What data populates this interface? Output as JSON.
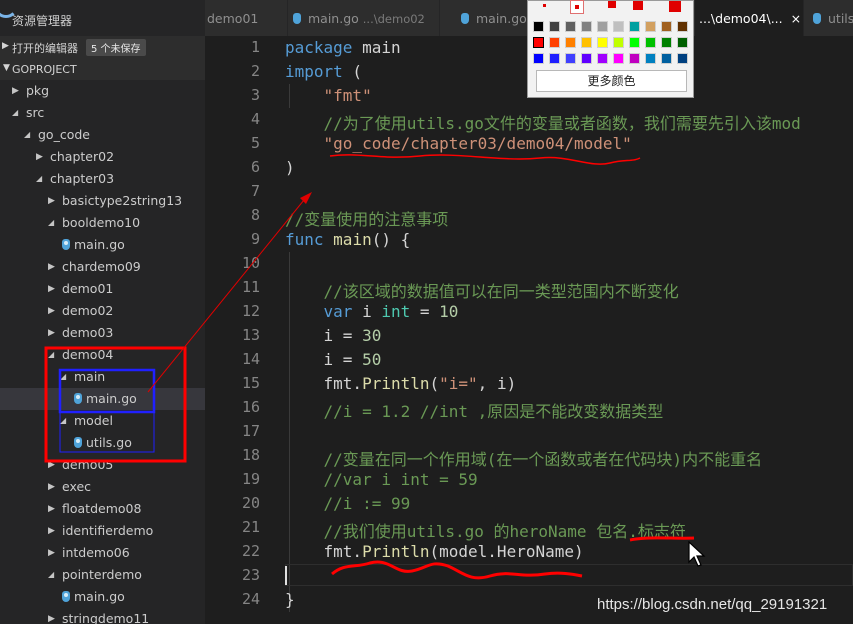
{
  "sidebar": {
    "title": "资源管理器",
    "open_editors": "打开的编辑器",
    "unsaved_badge": "5 个未保存",
    "project": "GOPROJECT",
    "tree": [
      {
        "label": "pkg",
        "depth": 0,
        "kind": "folder",
        "open": false
      },
      {
        "label": "src",
        "depth": 0,
        "kind": "folder",
        "open": true
      },
      {
        "label": "go_code",
        "depth": 1,
        "kind": "folder",
        "open": true
      },
      {
        "label": "chapter02",
        "depth": 2,
        "kind": "folder",
        "open": false
      },
      {
        "label": "chapter03",
        "depth": 2,
        "kind": "folder",
        "open": true
      },
      {
        "label": "basictype2string13",
        "depth": 3,
        "kind": "folder",
        "open": false
      },
      {
        "label": "booldemo10",
        "depth": 3,
        "kind": "folder",
        "open": true
      },
      {
        "label": "main.go",
        "depth": 4,
        "kind": "file"
      },
      {
        "label": "chardemo09",
        "depth": 3,
        "kind": "folder",
        "open": false
      },
      {
        "label": "demo01",
        "depth": 3,
        "kind": "folder",
        "open": false
      },
      {
        "label": "demo02",
        "depth": 3,
        "kind": "folder",
        "open": false
      },
      {
        "label": "demo03",
        "depth": 3,
        "kind": "folder",
        "open": false
      },
      {
        "label": "demo04",
        "depth": 3,
        "kind": "folder",
        "open": true
      },
      {
        "label": "main",
        "depth": 4,
        "kind": "folder",
        "open": true
      },
      {
        "label": "main.go",
        "depth": 5,
        "kind": "file",
        "selected": true
      },
      {
        "label": "model",
        "depth": 4,
        "kind": "folder",
        "open": true
      },
      {
        "label": "utils.go",
        "depth": 5,
        "kind": "file"
      },
      {
        "label": "demo05",
        "depth": 3,
        "kind": "folder",
        "open": false
      },
      {
        "label": "exec",
        "depth": 3,
        "kind": "folder",
        "open": false
      },
      {
        "label": "floatdemo08",
        "depth": 3,
        "kind": "folder",
        "open": false
      },
      {
        "label": "identifierdemo",
        "depth": 3,
        "kind": "folder",
        "open": false
      },
      {
        "label": "intdemo06",
        "depth": 3,
        "kind": "folder",
        "open": false
      },
      {
        "label": "pointerdemo",
        "depth": 3,
        "kind": "folder",
        "open": true
      },
      {
        "label": "main.go",
        "depth": 4,
        "kind": "file"
      },
      {
        "label": "stringdemo11",
        "depth": 3,
        "kind": "folder",
        "open": false
      }
    ]
  },
  "tabs": [
    {
      "name": "demo01",
      "path": "",
      "active": false
    },
    {
      "name": "main.go",
      "path": "...\\demo02",
      "active": false
    },
    {
      "name": "main.go",
      "path": "",
      "active": false
    },
    {
      "name": "...\\demo04\\...",
      "path": "",
      "active": true,
      "close": "×"
    },
    {
      "name": "utils",
      "path": "",
      "active": false
    }
  ],
  "color_picker": {
    "more_colors": "更多颜色",
    "colors": [
      "#000000",
      "#404040",
      "#606060",
      "#808080",
      "#a0a0a0",
      "#c0c0c0",
      "#00a0a0",
      "#d2a060",
      "#a06020",
      "#603000",
      "#ff0000",
      "#ff4000",
      "#ff8000",
      "#ffc000",
      "#ffff00",
      "#c0ff00",
      "#00ff00",
      "#00c000",
      "#008000",
      "#006000",
      "#0000ff",
      "#2020ff",
      "#4040ff",
      "#6000ff",
      "#a000ff",
      "#ff00ff",
      "#c000c0",
      "#0080c0",
      "#0060a0",
      "#004080"
    ]
  },
  "code_lines": [
    {
      "n": "1",
      "segs": [
        [
          "kw",
          "package"
        ],
        [
          "wh",
          " main"
        ]
      ]
    },
    {
      "n": "2",
      "segs": [
        [
          "kw",
          "import"
        ],
        [
          "wh",
          " ("
        ]
      ]
    },
    {
      "n": "3",
      "segs": [
        [
          "wh",
          "    "
        ],
        [
          "str",
          "\"fmt\""
        ]
      ]
    },
    {
      "n": "4",
      "segs": [
        [
          "wh",
          "    "
        ],
        [
          "cm",
          "//为了使用utils.go文件的变量或者函数，我们需要先引入该mod"
        ]
      ]
    },
    {
      "n": "5",
      "segs": [
        [
          "wh",
          "    "
        ],
        [
          "str",
          "\"go_code/chapter03/demo04/model\""
        ]
      ]
    },
    {
      "n": "6",
      "segs": [
        [
          "wh",
          ")"
        ]
      ]
    },
    {
      "n": "7",
      "segs": []
    },
    {
      "n": "8",
      "segs": [
        [
          "cm",
          "//变量使用的注意事项"
        ]
      ]
    },
    {
      "n": "9",
      "segs": [
        [
          "kw",
          "func"
        ],
        [
          "wh",
          " "
        ],
        [
          "fn",
          "main"
        ],
        [
          "wh",
          "() {"
        ]
      ]
    },
    {
      "n": "10",
      "segs": []
    },
    {
      "n": "11",
      "segs": [
        [
          "wh",
          "    "
        ],
        [
          "cm",
          "//该区域的数据值可以在同一类型范围内不断变化"
        ]
      ]
    },
    {
      "n": "12",
      "segs": [
        [
          "wh",
          "    "
        ],
        [
          "kw",
          "var"
        ],
        [
          "wh",
          " i "
        ],
        [
          "ty",
          "int"
        ],
        [
          "wh",
          " = "
        ],
        [
          "nu",
          "10"
        ]
      ]
    },
    {
      "n": "13",
      "segs": [
        [
          "wh",
          "    i = "
        ],
        [
          "nu",
          "30"
        ]
      ]
    },
    {
      "n": "14",
      "segs": [
        [
          "wh",
          "    i = "
        ],
        [
          "nu",
          "50"
        ]
      ]
    },
    {
      "n": "15",
      "segs": [
        [
          "wh",
          "    fmt."
        ],
        [
          "fn",
          "Println"
        ],
        [
          "wh",
          "("
        ],
        [
          "str",
          "\"i=\""
        ],
        [
          "wh",
          ", i)"
        ]
      ]
    },
    {
      "n": "16",
      "segs": [
        [
          "wh",
          "    "
        ],
        [
          "cm",
          "//i = 1.2 //int ,原因是不能改变数据类型"
        ]
      ]
    },
    {
      "n": "17",
      "segs": []
    },
    {
      "n": "18",
      "segs": [
        [
          "wh",
          "    "
        ],
        [
          "cm",
          "//变量在同一个作用域(在一个函数或者在代码块)内不能重名"
        ]
      ]
    },
    {
      "n": "19",
      "segs": [
        [
          "wh",
          "    "
        ],
        [
          "cm",
          "//var i int = 59"
        ]
      ]
    },
    {
      "n": "20",
      "segs": [
        [
          "wh",
          "    "
        ],
        [
          "cm",
          "//i := 99"
        ]
      ]
    },
    {
      "n": "21",
      "segs": [
        [
          "wh",
          "    "
        ],
        [
          "cm",
          "//我们使用utils.go 的heroName 包名.标志符"
        ]
      ]
    },
    {
      "n": "22",
      "segs": [
        [
          "wh",
          "    fmt."
        ],
        [
          "fn",
          "Println"
        ],
        [
          "wh",
          "(model.HeroName)"
        ]
      ]
    },
    {
      "n": "23",
      "segs": []
    },
    {
      "n": "24",
      "segs": [
        [
          "wh",
          "}"
        ]
      ]
    }
  ],
  "watermark": "https://blog.csdn.net/qq_29191321"
}
